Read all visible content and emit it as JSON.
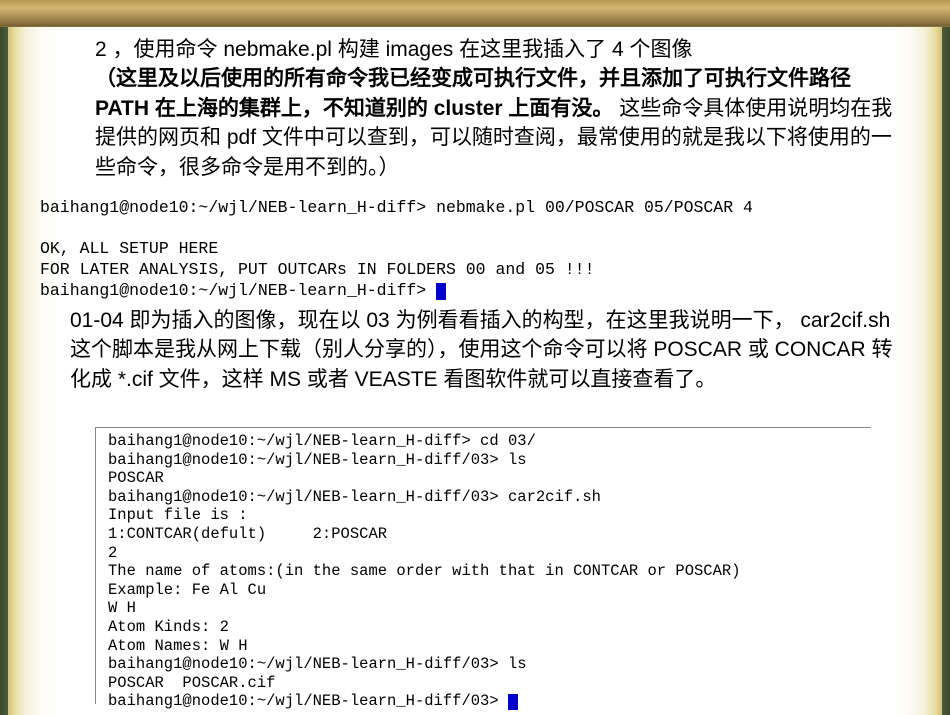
{
  "para1": {
    "l1": "2 ，使用命令 nebmake.pl 构建 images  在这里我插入了 4 个图像",
    "l2": "（这里及以后使用的所有命令我已经变成可执行文件，并且添加了可执行文件路径 PATH 在上海的集群上，不知道别的 cluster 上面有没。",
    "l3": "这些命令具体使用说明均在我提供的网页和 pdf 文件中可以查到，可以随时查阅，最常使用的就是我以下将使用的一些命令，很多命令是用不到的。）"
  },
  "term1": {
    "l1": "baihang1@node10:~/wjl/NEB-learn_H-diff> nebmake.pl 00/POSCAR 05/POSCAR 4",
    "l2": "",
    "l3": "OK, ALL SETUP HERE",
    "l4": "FOR LATER ANALYSIS, PUT OUTCARs IN FOLDERS 00 and 05 !!!",
    "l5": "baihang1@node10:~/wjl/NEB-learn_H-diff> "
  },
  "para2": "01-04 即为插入的图像，现在以 03 为例看看插入的构型，在这里我说明一下， car2cif.sh 这个脚本是我从网上下载（别人分享的），使用这个命令可以将 POSCAR 或 CONCAR 转化成 *.cif 文件，这样 MS 或者 VEASTE 看图软件就可以直接查看了。",
  "term2": {
    "l1": "baihang1@node10:~/wjl/NEB-learn_H-diff> cd 03/",
    "l2": "baihang1@node10:~/wjl/NEB-learn_H-diff/03> ls",
    "l3": "POSCAR",
    "l4": "baihang1@node10:~/wjl/NEB-learn_H-diff/03> car2cif.sh",
    "l5": "Input file is :",
    "l6": "1:CONTCAR(defult)     2:POSCAR",
    "l7": "2",
    "l8": "The name of atoms:(in the same order with that in CONTCAR or POSCAR)",
    "l9": "Example: Fe Al Cu",
    "l10": "W H",
    "l11": "Atom Kinds: 2",
    "l12": "Atom Names: W H",
    "l13": "baihang1@node10:~/wjl/NEB-learn_H-diff/03> ls",
    "l14": "POSCAR  POSCAR.cif",
    "l15": "baihang1@node10:~/wjl/NEB-learn_H-diff/03> "
  }
}
